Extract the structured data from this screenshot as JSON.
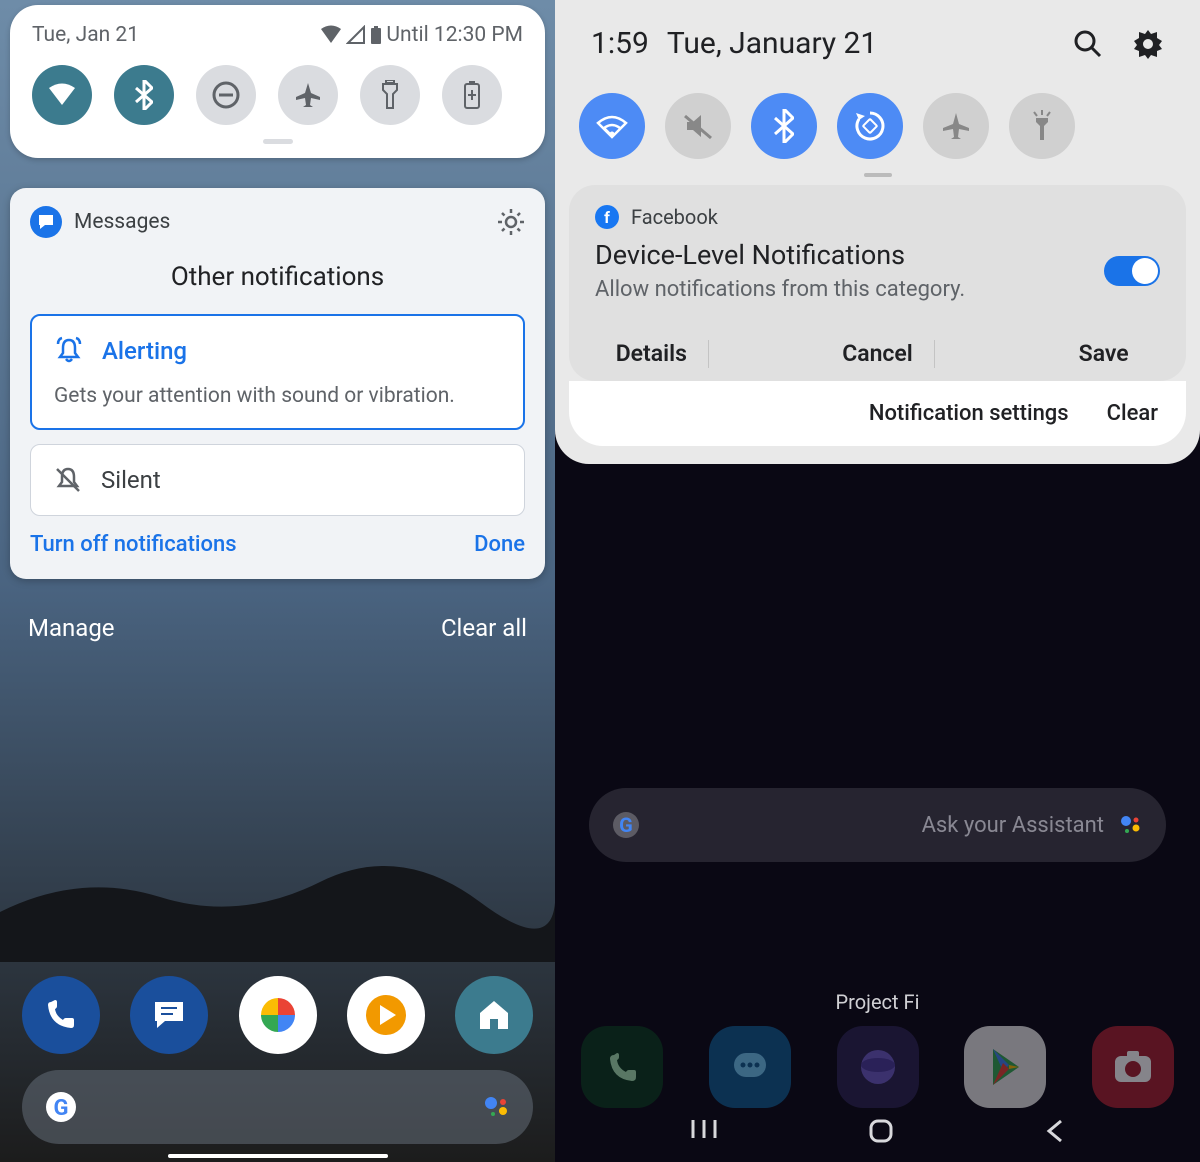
{
  "left": {
    "status": {
      "date": "Tue, Jan 21",
      "batteryText": "Until 12:30 PM"
    },
    "notif": {
      "app": "Messages",
      "title": "Other notifications",
      "alerting": {
        "label": "Alerting",
        "desc": "Gets your attention with sound or vibration."
      },
      "silent": {
        "label": "Silent"
      },
      "turnOff": "Turn off notifications",
      "done": "Done"
    },
    "shade": {
      "manage": "Manage",
      "clearAll": "Clear all"
    }
  },
  "right": {
    "head": {
      "time": "1:59",
      "date": "Tue, January 21"
    },
    "card": {
      "app": "Facebook",
      "title": "Device-Level Notifications",
      "sub": "Allow notifications from this category.",
      "details": "Details",
      "cancel": "Cancel",
      "save": "Save"
    },
    "footer": {
      "settings": "Notification settings",
      "clear": "Clear"
    },
    "search": {
      "placeholder": "Ask your Assistant"
    },
    "dockLabel": "Project Fi"
  }
}
